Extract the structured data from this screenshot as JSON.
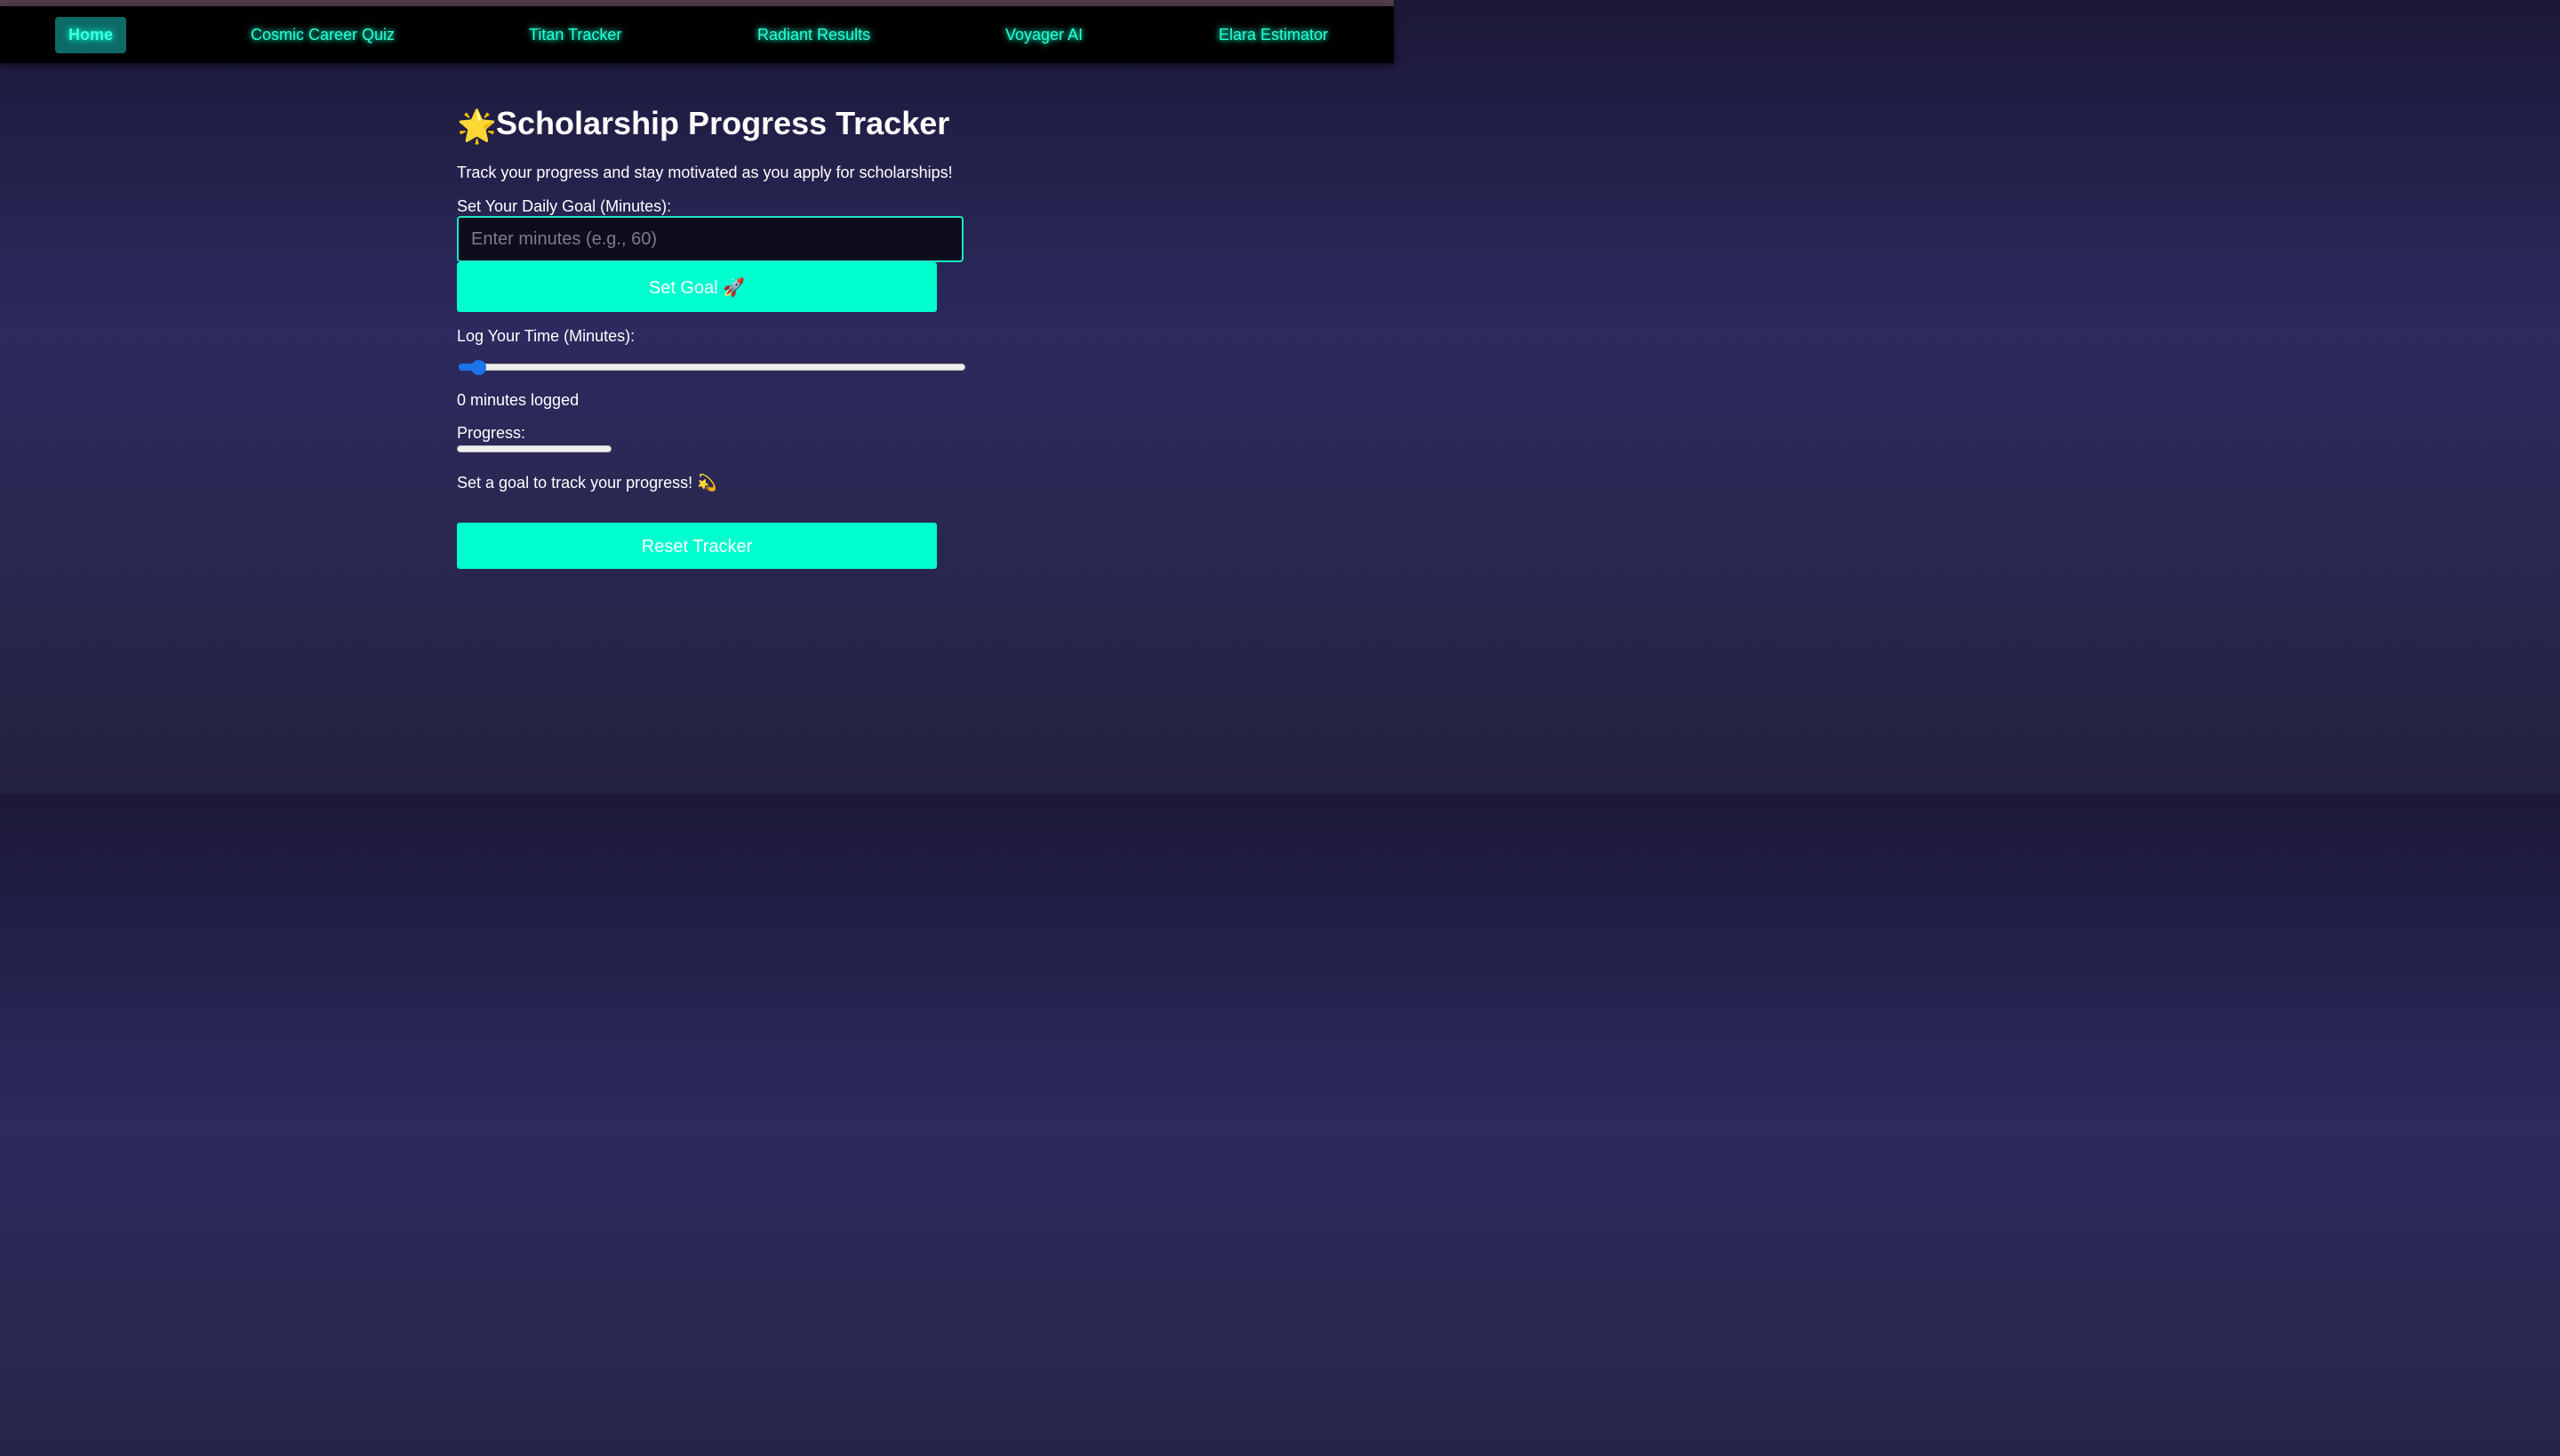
{
  "nav": {
    "items": [
      {
        "label": "Home"
      },
      {
        "label": "Cosmic Career Quiz"
      },
      {
        "label": "Titan Tracker"
      },
      {
        "label": "Radiant Results"
      },
      {
        "label": "Voyager AI"
      },
      {
        "label": "Elara Estimator"
      }
    ],
    "active": "Home"
  },
  "page": {
    "title_icon": "🌟",
    "title": "Scholarship Progress Tracker",
    "description": "Track your progress and stay motivated as you apply for scholarships!"
  },
  "goal": {
    "label": "Set Your Daily Goal (Minutes):",
    "placeholder": "Enter minutes (e.g., 60)",
    "value": "",
    "button_label": "Set Goal 🚀"
  },
  "log": {
    "label": "Log Your Time (Minutes):",
    "slider_value": 0,
    "logged_text": "0 minutes logged"
  },
  "progress": {
    "label": "Progress:",
    "value": 0,
    "status_text": "Set a goal to track your progress! 💫"
  },
  "reset": {
    "button_label": "Reset Tracker"
  },
  "colors": {
    "accent": "#00ffcf",
    "nav_text": "#2bffd8",
    "slider": "#1a73e8"
  }
}
